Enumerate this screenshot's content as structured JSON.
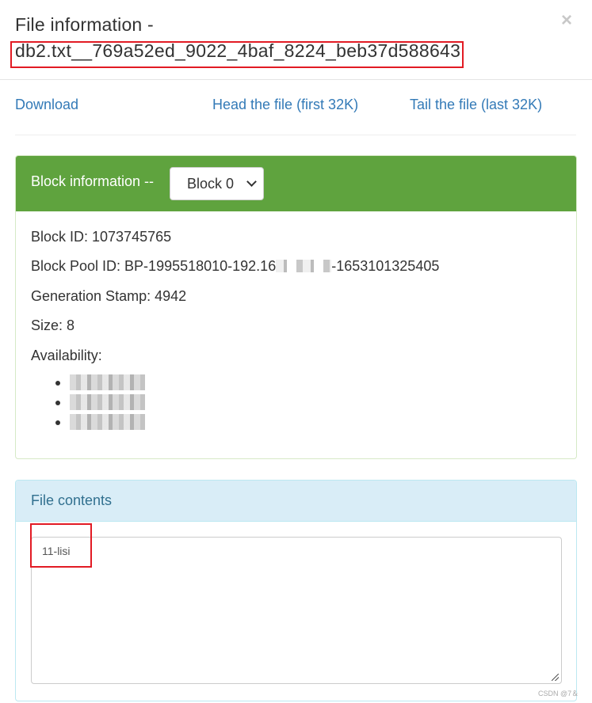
{
  "header": {
    "title_prefix": "File information -",
    "file_name": "db2.txt__769a52ed_9022_4baf_8224_beb37d588643",
    "close_icon": "×"
  },
  "links": {
    "download": "Download",
    "head": "Head the file (first 32K)",
    "tail": "Tail the file (last 32K)"
  },
  "block_panel": {
    "heading": "Block information --",
    "select": {
      "selected": "Block 0",
      "options": [
        "Block 0"
      ]
    },
    "block_id": "Block ID: 1073745765",
    "block_pool_prefix": "Block Pool ID: BP-1995518010-192.16",
    "block_pool_suffix": "-1653101325405",
    "generation_stamp": "Generation Stamp: 4942",
    "size": "Size: 8",
    "availability_label": "Availability:",
    "availability_items": [
      "[redacted]",
      "[redacted]",
      "[redacted]"
    ]
  },
  "contents_panel": {
    "heading": "File contents",
    "text": "11-lisi"
  },
  "colors": {
    "block_heading_bg": "#5fa33e",
    "contents_heading_bg": "#d9edf7",
    "link": "#337ab7",
    "highlight": "#e21b24"
  },
  "watermark": "CSDN @7＆"
}
